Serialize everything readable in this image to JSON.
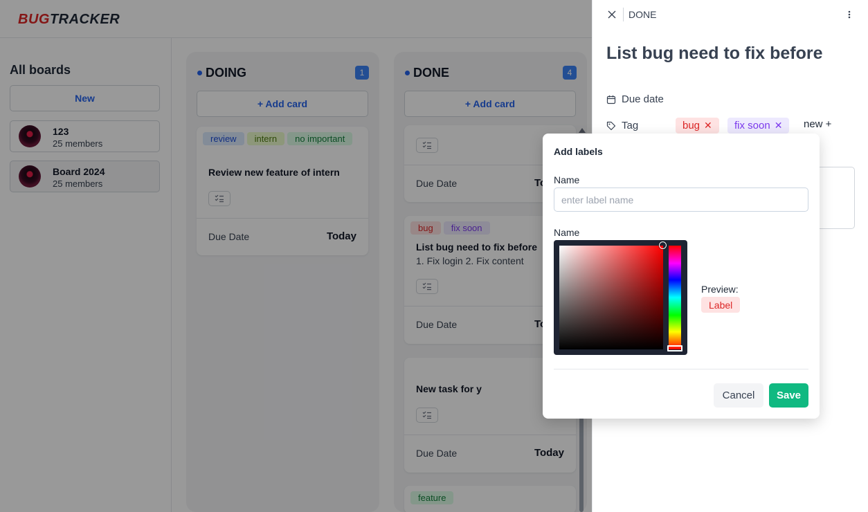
{
  "app": {
    "logo_part1": "BUG",
    "logo_part2": "TRACKER"
  },
  "sidebar": {
    "heading": "All boards",
    "new_label": "New",
    "boards": [
      {
        "name": "123",
        "members": "25 members"
      },
      {
        "name": "Board 2024",
        "members": "25 members"
      }
    ]
  },
  "columns": [
    {
      "title": "DOING",
      "count": "1",
      "add_label": "+ Add card",
      "cards": [
        {
          "tags": [
            {
              "text": "review",
              "bg": "#dbeafe",
              "fg": "#1d4ed8"
            },
            {
              "text": "intern",
              "bg": "#ecfccb",
              "fg": "#4d7c0f"
            },
            {
              "text": "no important",
              "bg": "#dcfce7",
              "fg": "#15803d"
            }
          ],
          "title": "Review new feature of intern",
          "due_label": "Due Date",
          "due_value": "Today"
        }
      ]
    },
    {
      "title": "DONE",
      "count": "4",
      "add_label": "+ Add card",
      "cards": [
        {
          "title": "",
          "due_label": "Due Date",
          "due_value": "Today"
        },
        {
          "tags": [
            {
              "text": "bug",
              "bg": "#fee2e2",
              "fg": "#dc2626"
            },
            {
              "text": "fix soon",
              "bg": "#ede9fe",
              "fg": "#7c3aed"
            }
          ],
          "title": "List bug need to fix before",
          "description": "1. Fix login 2. Fix content",
          "due_label": "Due Date",
          "due_value": "Today"
        },
        {
          "title": "New task for y",
          "due_label": "Due Date",
          "due_value": "Today"
        },
        {
          "tags": [
            {
              "text": "feature",
              "bg": "#dcfce7",
              "fg": "#15803d"
            }
          ]
        }
      ]
    }
  ],
  "panel": {
    "status": "DONE",
    "title": "List bug need to fix before",
    "due_date_label": "Due date",
    "tag_label": "Tag",
    "tags": [
      {
        "text": "bug",
        "bg": "#fee2e2",
        "fg": "#dc2626"
      },
      {
        "text": "fix soon",
        "bg": "#ede9fe",
        "fg": "#7c3aed"
      }
    ],
    "new_tag_label": "new +"
  },
  "modal": {
    "title": "Add labels",
    "name_label": "Name",
    "name_placeholder": "enter label name",
    "name_value": "",
    "color_label": "Name",
    "preview_label": "Preview:",
    "preview_chip": "Label",
    "cancel_label": "Cancel",
    "save_label": "Save",
    "selected_color": "#ff0000"
  }
}
